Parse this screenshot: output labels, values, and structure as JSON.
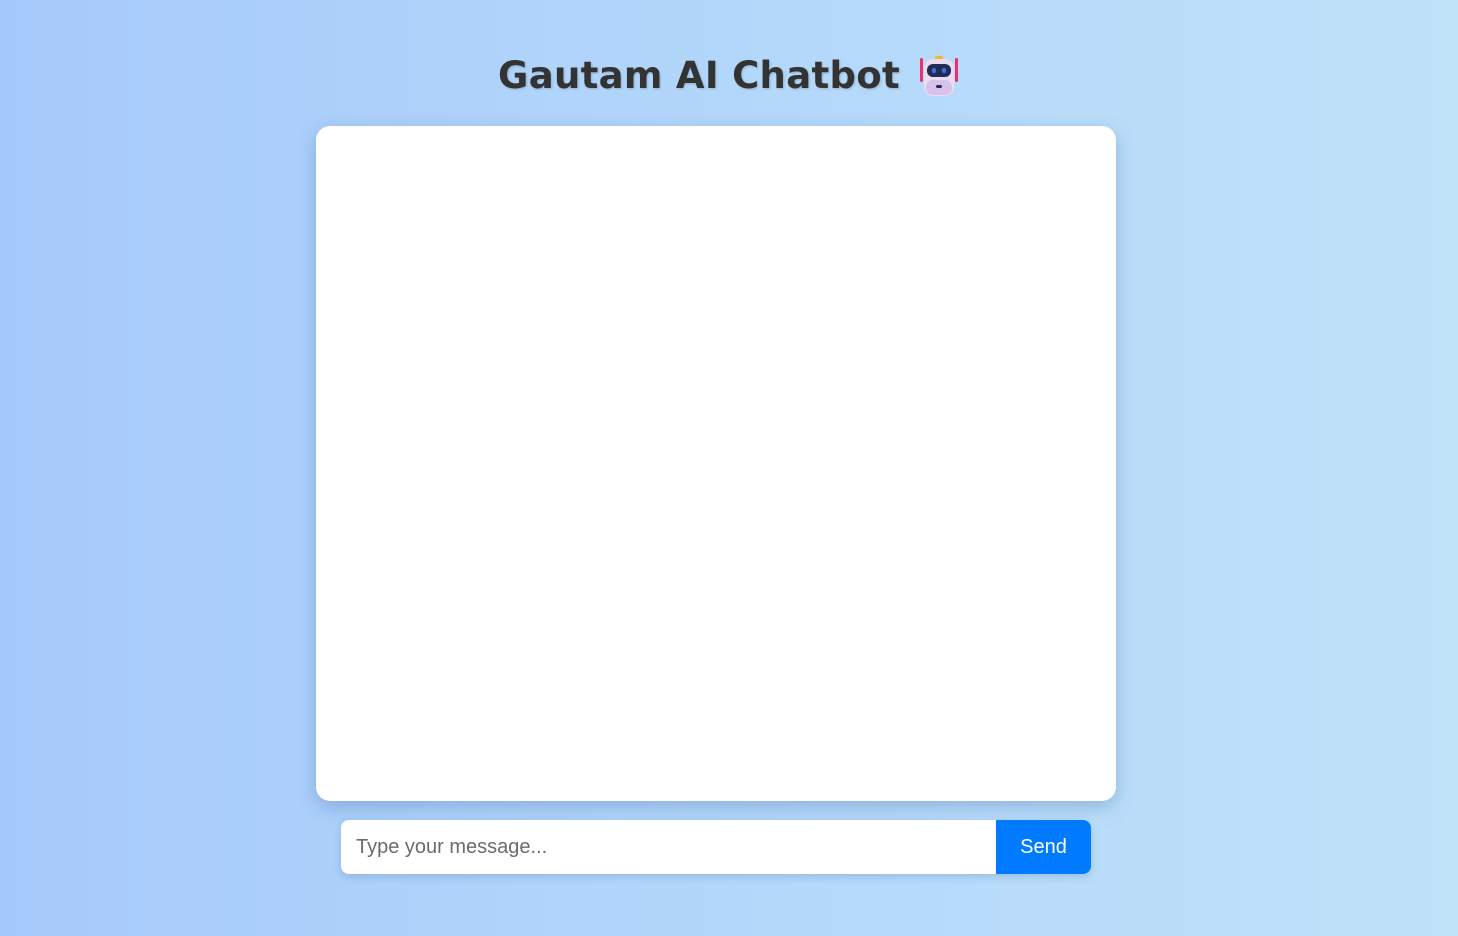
{
  "header": {
    "title": "Gautam AI Chatbot",
    "icon": "robot-icon"
  },
  "chat": {
    "messages": []
  },
  "composer": {
    "placeholder": "Type your message...",
    "value": "",
    "send_label": "Send"
  },
  "colors": {
    "accent": "#007bff",
    "background_start": "#a6c9fb",
    "background_end": "#bfe3f9",
    "title": "#333333"
  }
}
